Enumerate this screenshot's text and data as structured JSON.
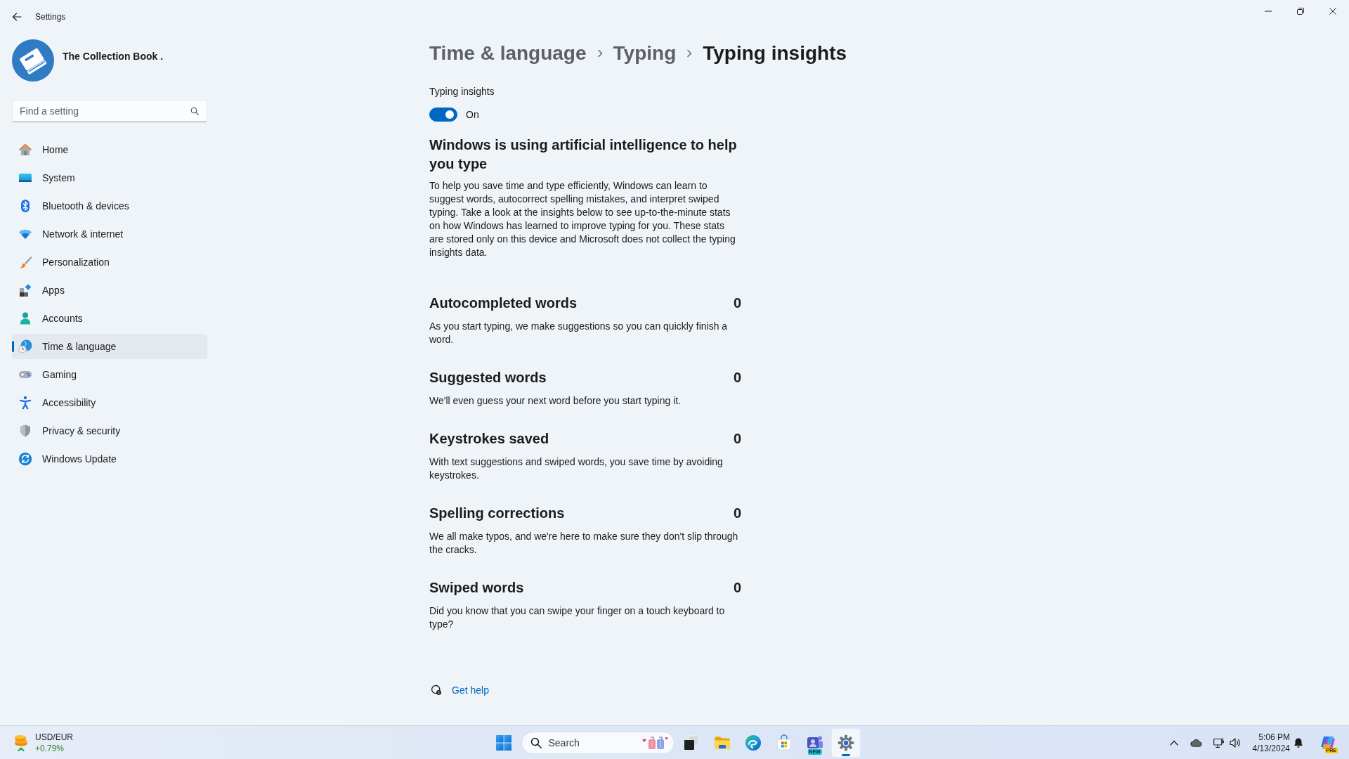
{
  "window": {
    "title": "Settings"
  },
  "account": {
    "name": "The Collection Book ."
  },
  "search": {
    "placeholder": "Find a setting"
  },
  "sidebar": {
    "items": [
      {
        "label": "Home",
        "selected": false
      },
      {
        "label": "System",
        "selected": false
      },
      {
        "label": "Bluetooth & devices",
        "selected": false
      },
      {
        "label": "Network & internet",
        "selected": false
      },
      {
        "label": "Personalization",
        "selected": false
      },
      {
        "label": "Apps",
        "selected": false
      },
      {
        "label": "Accounts",
        "selected": false
      },
      {
        "label": "Time & language",
        "selected": true
      },
      {
        "label": "Gaming",
        "selected": false
      },
      {
        "label": "Accessibility",
        "selected": false
      },
      {
        "label": "Privacy & security",
        "selected": false
      },
      {
        "label": "Windows Update",
        "selected": false
      }
    ]
  },
  "breadcrumb": [
    "Time & language",
    "Typing",
    "Typing insights"
  ],
  "typing_insights": {
    "label": "Typing insights",
    "on": true,
    "state_text": "On"
  },
  "intro": {
    "heading": "Windows is using artificial intelligence to help you type",
    "body": "To help you save time and type efficiently, Windows can learn to suggest words, autocorrect spelling mistakes, and interpret swiped typing. Take a look at the insights below to see up-to-the-minute stats on how Windows has learned to improve typing for you. These stats are stored only on this device and Microsoft does not collect the typing insights data."
  },
  "stats": [
    {
      "title": "Autocompleted words",
      "value": "0",
      "description": "As you start typing, we make suggestions so you can quickly finish a word."
    },
    {
      "title": "Suggested words",
      "value": "0",
      "description": "We'll even guess your next word before you start typing it."
    },
    {
      "title": "Keystrokes saved",
      "value": "0",
      "description": "With text suggestions and swiped words, you save time by avoiding keystrokes."
    },
    {
      "title": "Spelling corrections",
      "value": "0",
      "description": "We all make typos, and we're here to make sure they don't slip through the cracks."
    },
    {
      "title": "Swiped words",
      "value": "0",
      "description": "Did you know that you can swipe your finger on a touch keyboard to type?"
    }
  ],
  "help_link": "Get help",
  "taskbar": {
    "widget": {
      "title": "USD/EUR",
      "change": "+0.79%"
    },
    "search": {
      "placeholder": "Search"
    },
    "apps": [
      {
        "selected": false
      },
      {
        "selected": false
      },
      {
        "selected": false
      },
      {
        "selected": false
      },
      {
        "badge": "NEW",
        "selected": false
      },
      {
        "selected": true
      }
    ],
    "tray": {
      "time": "5:06 PM",
      "date": "4/13/2024",
      "badge": "PRE"
    }
  }
}
